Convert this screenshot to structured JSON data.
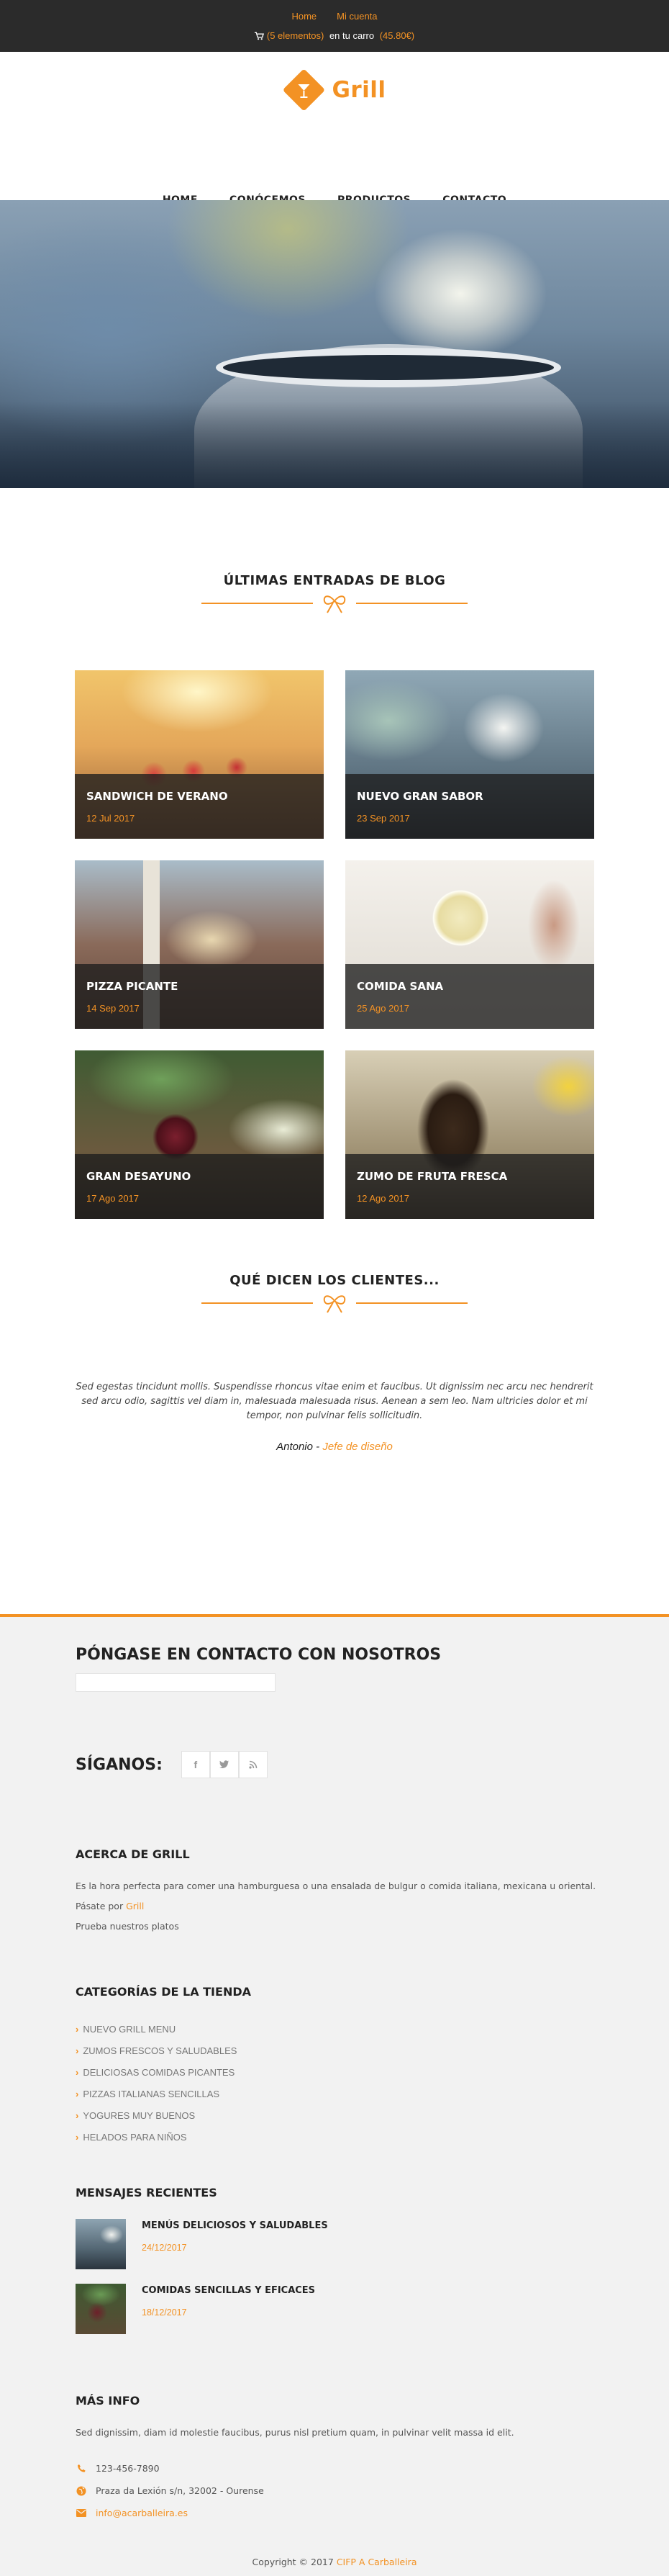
{
  "topbar": {
    "links": [
      "Home",
      "Mi cuenta"
    ],
    "cart": {
      "count_text": "(5 elementos)",
      "middle": " en tu carro ",
      "total": "(45.80€)"
    }
  },
  "header": {
    "logo_text": "Grill",
    "nav": [
      "HOME",
      "CONÓCEMOS",
      "PRODUCTOS",
      "CONTACTO"
    ]
  },
  "blog": {
    "title": "ÚLTIMAS ENTRADAS DE BLOG",
    "posts": [
      {
        "title": "SANDWICH DE VERANO",
        "date": "12 Jul 2017"
      },
      {
        "title": "NUEVO GRAN SABOR",
        "date": "23 Sep 2017"
      },
      {
        "title": "PIZZA PICANTE",
        "date": "14 Sep 2017"
      },
      {
        "title": "COMIDA SANA",
        "date": "25 Ago 2017"
      },
      {
        "title": "GRAN DESAYUNO",
        "date": "17 Ago 2017"
      },
      {
        "title": "ZUMO DE FRUTA FRESCA",
        "date": "12 Ago 2017"
      }
    ]
  },
  "testimonials": {
    "title": "QUÉ DICEN LOS CLIENTES...",
    "quote": "Sed egestas tincidunt mollis. Suspendisse rhoncus vitae enim et faucibus. Ut dignissim nec arcu nec hendrerit sed arcu odio, sagittis vel diam in, malesuada malesuada risus. Aenean a sem leo. Nam ultricies dolor et mi tempor, non pulvinar felis sollicitudin.",
    "author": "Antonio",
    "separator": " - ",
    "role": "Jefe de diseño"
  },
  "footer": {
    "contact_title": "PÓNGASE EN CONTACTO CON NOSOTROS",
    "follow_title": "SÍGANOS:",
    "social": [
      "f",
      "t",
      "rss"
    ],
    "about": {
      "title": "ACERCA DE GRILL",
      "line1": "Es la hora perfecta para comer una hamburguesa o una ensalada de bulgur o comida italiana, mexicana u oriental.",
      "line2_prefix": "Pásate por ",
      "line2_link": "Grill",
      "line3": "Prueba nuestros platos"
    },
    "categories": {
      "title": "CATEGORÍAS DE LA TIENDA",
      "items": [
        "NUEVO GRILL MENU",
        "ZUMOS FRESCOS Y SALUDABLES",
        "DELICIOSAS COMIDAS PICANTES",
        "PIZZAS ITALIANAS SENCILLAS",
        "YOGURES MUY BUENOS",
        "HELADOS PARA NIÑOS"
      ]
    },
    "recent": {
      "title": "MENSAJES RECIENTES",
      "posts": [
        {
          "title": "MENÚS DELICIOSOS Y SALUDABLES",
          "date": "24/12/2017"
        },
        {
          "title": "COMIDAS SENCILLAS Y EFICACES",
          "date": "18/12/2017"
        }
      ]
    },
    "more": {
      "title": "MÁS INFO",
      "text": "Sed dignissim, diam id molestie faucibus, purus nisl pretium quam, in pulvinar velit massa id elit.",
      "phone": "123-456-7890",
      "address": "Praza da Lexión s/n, 32002 - Ourense",
      "email": "info@acarballeira.es"
    },
    "copyright_prefix": "Copyright © 2017 ",
    "copyright_link": "CIFP A Carballeira"
  },
  "colors": {
    "accent": "#f39224",
    "topbar": "#2b2b2b",
    "footer_bg": "#f2f2f2"
  }
}
